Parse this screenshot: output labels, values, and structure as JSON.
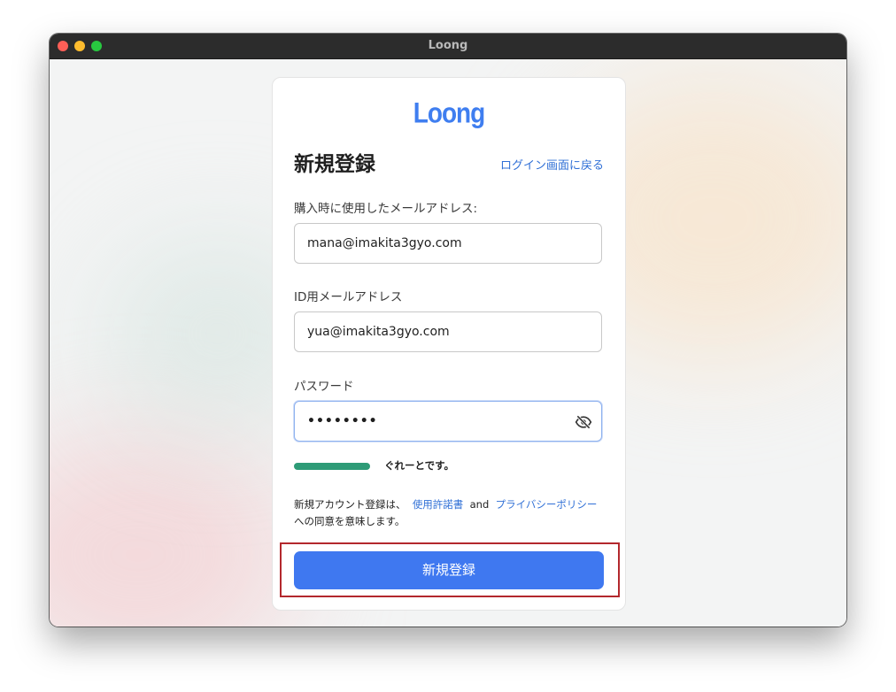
{
  "window": {
    "title": "Loong"
  },
  "brand": {
    "logo_text": "Loong",
    "accent_color": "#3f78f0",
    "link_color": "#2f6fd6",
    "strength_color": "#2e9b77",
    "highlight_color": "#b3282d"
  },
  "form": {
    "heading": "新規登録",
    "back_link": "ログイン画面に戻る",
    "purchase_email": {
      "label": "購入時に使用したメールアドレス:",
      "value": "mana@imakita3gyo.com"
    },
    "id_email": {
      "label": "ID用メールアドレス",
      "value": "yua@imakita3gyo.com"
    },
    "password": {
      "label": "パスワード",
      "masked_value": "••••••••",
      "toggle_icon": "eye-off-icon"
    },
    "strength": {
      "text": "ぐれーとです。",
      "level": 1.0
    },
    "terms": {
      "prefix": "新規アカウント登録は、",
      "license_link": "使用許諾書",
      "conjunction": "and",
      "privacy_link": "プライバシーポリシー",
      "suffix": "への同意を意味します。"
    },
    "submit_label": "新規登録"
  }
}
